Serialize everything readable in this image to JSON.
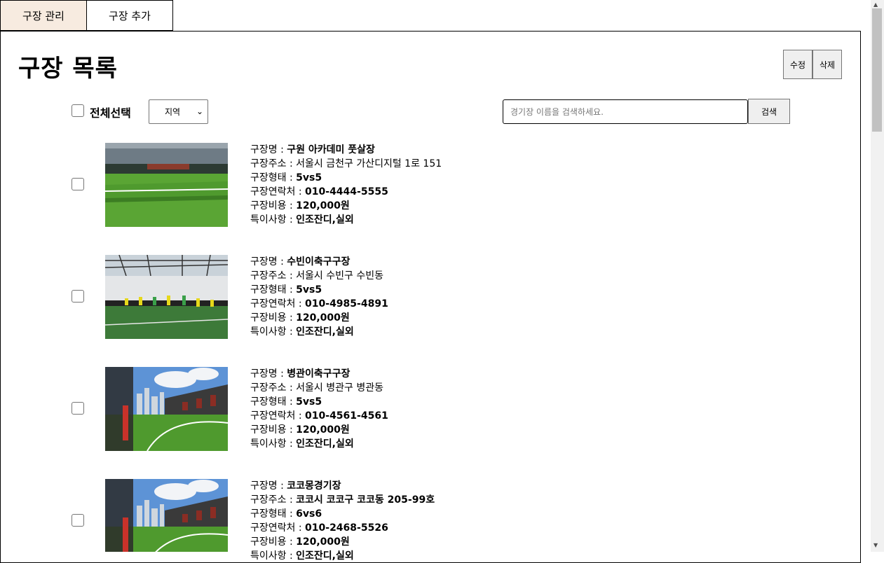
{
  "tabs": {
    "manage": "구장 관리",
    "add": "구장 추가"
  },
  "page": {
    "title": "구장 목록"
  },
  "actions": {
    "edit": "수정",
    "delete": "삭제"
  },
  "filter": {
    "select_all": "전체선택",
    "region_selected": "지역"
  },
  "search": {
    "placeholder": "경기장 이름을 검색하세요.",
    "button": "검색"
  },
  "labels": {
    "name": "구장명 : ",
    "address": "구장주소 : ",
    "type": "구장형태 : ",
    "contact": "구장연락처 : ",
    "fee": "구장비용 : ",
    "notes": "특이사항 : "
  },
  "fields": [
    {
      "name": "구원 아카데미 풋살장",
      "address": "서울시 금천구 가산디지털 1로 151",
      "type": "5vs5",
      "contact": "010-4444-5555",
      "fee": "120,000원",
      "notes": "인조잔디,실외"
    },
    {
      "name": "수빈이축구구장",
      "address": "서울시 수빈구 수빈동",
      "type": "5vs5",
      "contact": "010-4985-4891",
      "fee": "120,000원",
      "notes": "인조잔디,실외"
    },
    {
      "name": "병관이축구구장",
      "address": "서울시 병관구 병관동",
      "type": "5vs5",
      "contact": "010-4561-4561",
      "fee": "120,000원",
      "notes": "인조잔디,실외"
    },
    {
      "name": "코코몽경기장",
      "address": "코코시 코코구 코코동 205-99호",
      "type": "6vs6",
      "contact": "010-2468-5526",
      "fee": "120,000원",
      "notes": "인조잔디,실외"
    }
  ],
  "colors": {
    "active_tab": "#f7ebe0",
    "grass": "#4a8f2a",
    "sky": "#5d93d6"
  }
}
